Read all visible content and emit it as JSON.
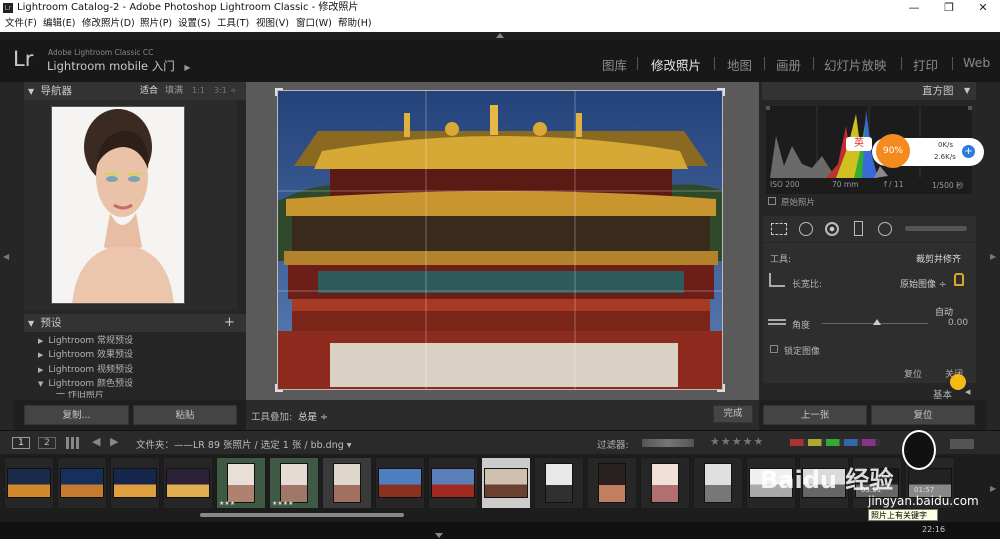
{
  "window": {
    "title": "Lightroom Catalog-2 - Adobe Photoshop Lightroom Classic - 修改照片",
    "controls": {
      "minimize": "—",
      "restore": "❐",
      "close": "✕"
    }
  },
  "menu": [
    "文件(F)",
    "编辑(E)",
    "修改照片(D)",
    "照片(P)",
    "设置(S)",
    "工具(T)",
    "视图(V)",
    "窗口(W)",
    "帮助(H)"
  ],
  "identity": {
    "logo": "Lr",
    "subtitle": "Adobe Lightroom Classic CC",
    "main": "Lightroom mobile 入门",
    "arrow": "▶"
  },
  "modules": [
    "图库",
    "修改照片",
    "地图",
    "画册",
    "幻灯片放映",
    "打印",
    "Web"
  ],
  "active_module": "修改照片",
  "navigator": {
    "title": "导航器",
    "zoom_options": [
      "适合",
      "填满",
      "1:1",
      "3:1"
    ],
    "zoom_arrow": "÷"
  },
  "presets": {
    "title": "预设",
    "add": "+",
    "items": [
      "Lightroom 常规预设",
      "Lightroom 效果预设",
      "Lightroom 视频预设",
      "Lightroom 颜色预设"
    ],
    "subitem": "一 作旧照片"
  },
  "left_buttons": {
    "copy": "复制...",
    "paste": "粘贴"
  },
  "toolbar": {
    "overlay_label": "工具叠加:",
    "overlay_value": "总是 ÷",
    "done": "完成"
  },
  "histogram": {
    "title": "直方图",
    "iso": "ISO 200",
    "focal": "70 mm",
    "aperture": "f / 11",
    "shutter": "1/500 秒",
    "original_label": "原始照片"
  },
  "crop": {
    "tool_label": "工具:",
    "tool_value": "裁剪并修齐",
    "aspect_label": "长宽比:",
    "aspect_value": "原始图像 ÷",
    "auto": "自动",
    "angle_label": "角度",
    "angle_value": "0.00",
    "lock_label": "锁定图像",
    "reset": "复位",
    "close": "关闭"
  },
  "right_buttons": {
    "prev": "上一张",
    "reset": "复位"
  },
  "panel_end": "基本",
  "overlay_widget": {
    "badge": "英",
    "percent": "90%",
    "up_speed": "0K/s",
    "down_speed": "2.6K/s"
  },
  "filmbar": {
    "view1": "1",
    "view2": "2",
    "folder_text": "文件夹：——LR  89 张照片 / 选定 1 张 / bb.dng ▾",
    "filter_label": "过滤器:",
    "stars": "★★★★★"
  },
  "filmstrip": {
    "count": 18,
    "selected_index": 9,
    "time_labels": [
      "05:51",
      "01:57"
    ],
    "stars_a": "★★★",
    "stars_b": "★★★★"
  },
  "watermark": {
    "brand": "Baidu 经验",
    "url": "jingyan.baidu.com",
    "tooltip": "照片上有关键字"
  },
  "footer": {
    "time": "22:16"
  },
  "colors": {
    "panel_bg": "#262626",
    "header_bg": "#333333",
    "center_bg": "#555555",
    "identity_bg": "#181818",
    "accent_orange": "#f58a1f",
    "sky_blue": "#2d4f8a"
  }
}
